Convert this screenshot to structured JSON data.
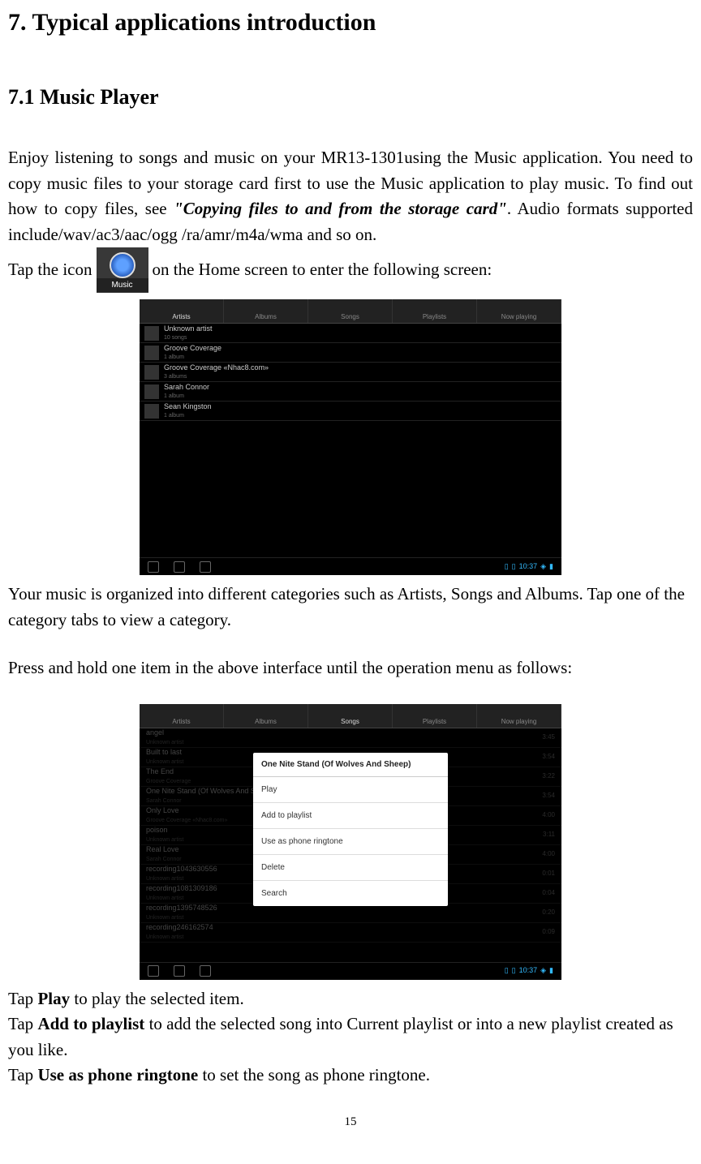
{
  "heading1": "7. Typical applications introduction",
  "heading2": "7.1 Music Player",
  "intro_p1a": "Enjoy listening to songs and music on your MR13-1301using the Music application. You need to copy music files to your storage card first to use the Music application to play music. To find out how to copy files, see ",
  "intro_p1b": "\"Copying files to and from the storage card\"",
  "intro_p1c": ". Audio formats supported include/wav/ac3/aac/ogg /ra/amr/m4a/wma and so on.",
  "tap_icon_a": "Tap the icon ",
  "tap_icon_b": " on the Home screen to enter the following screen:",
  "music_icon_label": "Music",
  "after_ss1_p1": "Your music is organized into different categories such as Artists, Songs and Albums. Tap one of the category tabs to view a category.",
  "press_hold": "Press and hold one item in the above interface until the operation menu as follows:",
  "tap_play_a": "Tap ",
  "tap_play_b": "Play",
  "tap_play_c": " to play the selected item.",
  "tap_add_a": "Tap ",
  "tap_add_b": "Add to playlist",
  "tap_add_c": " to add the selected song into Current playlist or into a new playlist created as you like.",
  "tap_ring_a": "Tap ",
  "tap_ring_b": "Use as phone ringtone",
  "tap_ring_c": " to set the song as phone ringtone.",
  "page_num": "15",
  "ss1": {
    "tabs": [
      "Artists",
      "Albums",
      "Songs",
      "Playlists",
      "Now playing"
    ],
    "artists": [
      {
        "name": "Unknown artist",
        "sub": "10 songs"
      },
      {
        "name": "Groove Coverage",
        "sub": "1 album"
      },
      {
        "name": "Groove Coverage «Nhac8.com»",
        "sub": "3 albums"
      },
      {
        "name": "Sarah Connor",
        "sub": "1 album"
      },
      {
        "name": "Sean Kingston",
        "sub": "1 album"
      }
    ],
    "time": "10:37"
  },
  "ss2": {
    "tabs": [
      "Artists",
      "Albums",
      "Songs",
      "Playlists",
      "Now playing"
    ],
    "songs": [
      {
        "title": "angel",
        "artist": "Unknown artist",
        "dur": "3:45"
      },
      {
        "title": "Built to last",
        "artist": "Unknown artist",
        "dur": "3:54"
      },
      {
        "title": "The End",
        "artist": "Groove Coverage",
        "dur": "3:22"
      },
      {
        "title": "One Nite Stand (Of Wolves And Sheep)",
        "artist": "Sarah Connor",
        "dur": "3:54"
      },
      {
        "title": "Only Love",
        "artist": "Groove Coverage «Nhac8.com»",
        "dur": "4:00"
      },
      {
        "title": "poison",
        "artist": "Unknown artist",
        "dur": "3:11"
      },
      {
        "title": "Real Love",
        "artist": "Sarah Connor",
        "dur": "4:00"
      },
      {
        "title": "recording1043630556",
        "artist": "Unknown artist",
        "dur": "0:01"
      },
      {
        "title": "recording1081309186",
        "artist": "Unknown artist",
        "dur": "0:04"
      },
      {
        "title": "recording1395748526",
        "artist": "Unknown artist",
        "dur": "0:20"
      },
      {
        "title": "recording246162574",
        "artist": "Unknown artist",
        "dur": "0:09"
      }
    ],
    "dialog_title": "One Nite Stand (Of Wolves And Sheep)",
    "dialog_items": [
      "Play",
      "Add to playlist",
      "Use as phone ringtone",
      "Delete",
      "Search"
    ],
    "time": "10:37"
  }
}
